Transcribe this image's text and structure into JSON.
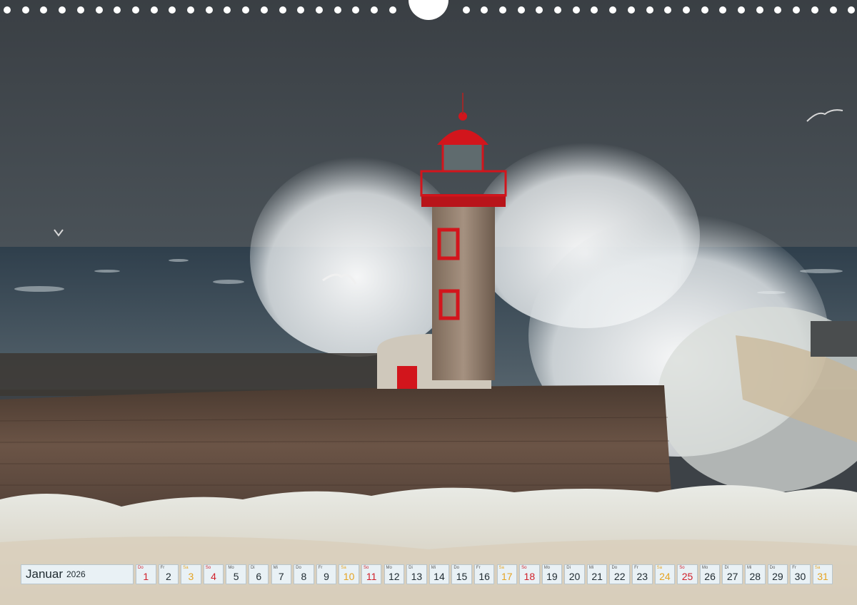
{
  "calendar": {
    "month": "Januar",
    "year": "2026",
    "days": [
      {
        "wd": "Do",
        "n": "1",
        "kind": "hol"
      },
      {
        "wd": "Fr",
        "n": "2",
        "kind": ""
      },
      {
        "wd": "Sa",
        "n": "3",
        "kind": "sat"
      },
      {
        "wd": "So",
        "n": "4",
        "kind": "sun"
      },
      {
        "wd": "Mo",
        "n": "5",
        "kind": ""
      },
      {
        "wd": "Di",
        "n": "6",
        "kind": ""
      },
      {
        "wd": "Mi",
        "n": "7",
        "kind": ""
      },
      {
        "wd": "Do",
        "n": "8",
        "kind": ""
      },
      {
        "wd": "Fr",
        "n": "9",
        "kind": ""
      },
      {
        "wd": "Sa",
        "n": "10",
        "kind": "sat"
      },
      {
        "wd": "So",
        "n": "11",
        "kind": "sun"
      },
      {
        "wd": "Mo",
        "n": "12",
        "kind": ""
      },
      {
        "wd": "Di",
        "n": "13",
        "kind": ""
      },
      {
        "wd": "Mi",
        "n": "14",
        "kind": ""
      },
      {
        "wd": "Do",
        "n": "15",
        "kind": ""
      },
      {
        "wd": "Fr",
        "n": "16",
        "kind": ""
      },
      {
        "wd": "Sa",
        "n": "17",
        "kind": "sat"
      },
      {
        "wd": "So",
        "n": "18",
        "kind": "sun"
      },
      {
        "wd": "Mo",
        "n": "19",
        "kind": ""
      },
      {
        "wd": "Di",
        "n": "20",
        "kind": ""
      },
      {
        "wd": "Mi",
        "n": "21",
        "kind": ""
      },
      {
        "wd": "Do",
        "n": "22",
        "kind": ""
      },
      {
        "wd": "Fr",
        "n": "23",
        "kind": ""
      },
      {
        "wd": "Sa",
        "n": "24",
        "kind": "sat"
      },
      {
        "wd": "So",
        "n": "25",
        "kind": "sun"
      },
      {
        "wd": "Mo",
        "n": "26",
        "kind": ""
      },
      {
        "wd": "Di",
        "n": "27",
        "kind": ""
      },
      {
        "wd": "Mi",
        "n": "28",
        "kind": ""
      },
      {
        "wd": "Do",
        "n": "29",
        "kind": ""
      },
      {
        "wd": "Fr",
        "n": "30",
        "kind": ""
      },
      {
        "wd": "Sa",
        "n": "31",
        "kind": "sat"
      }
    ]
  },
  "colors": {
    "saturday": "#e5a423",
    "sunday": "#d0202a",
    "lighthouse": "#d2151c",
    "sky": "#3f4449"
  }
}
